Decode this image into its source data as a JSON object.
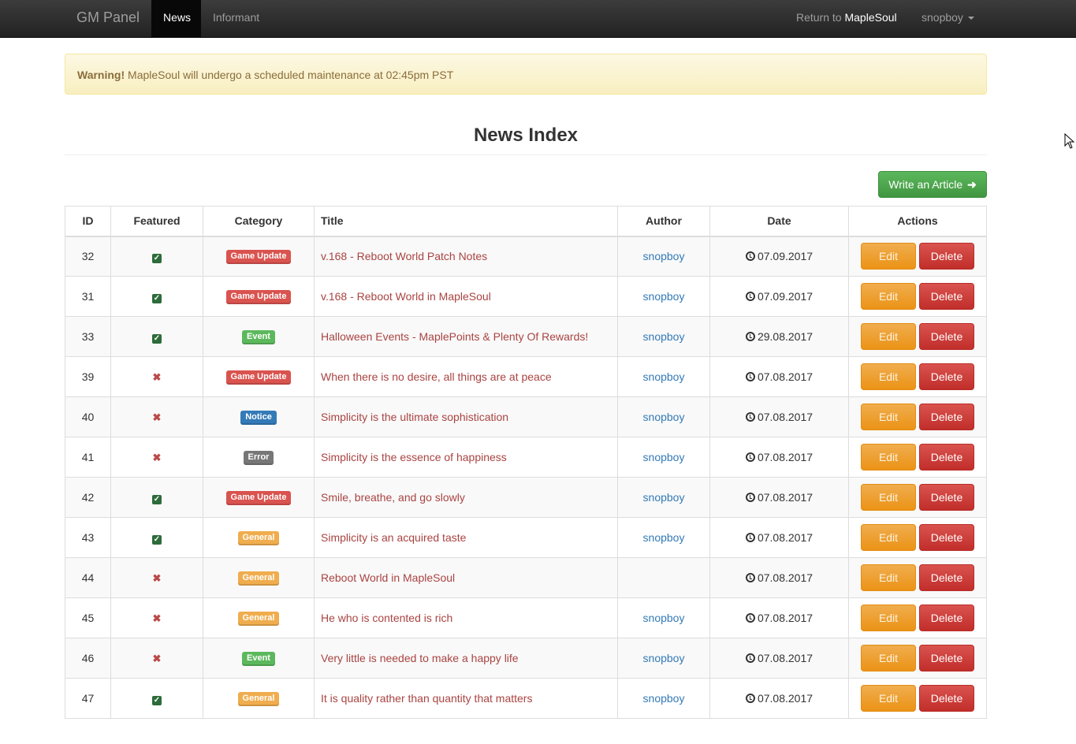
{
  "navbar": {
    "brand": "GM Panel",
    "items": [
      {
        "label": "News",
        "active": true
      },
      {
        "label": "Informant",
        "active": false
      }
    ],
    "return_prefix": "Return to ",
    "return_site": "MapleSoul",
    "user": "snopboy"
  },
  "alert": {
    "strong": "Warning!",
    "message": " MapleSoul will undergo a scheduled maintenance at 02:45pm PST"
  },
  "page": {
    "title": "News Index",
    "write_button": "Write an Article",
    "write_icon": "arrow-right-icon"
  },
  "table": {
    "headers": [
      "ID",
      "Featured",
      "Category",
      "Title",
      "Author",
      "Date",
      "Actions"
    ],
    "edit_label": "Edit",
    "delete_label": "Delete",
    "category_colors": {
      "Game Update": "#d9534f",
      "Event": "#5cb85c",
      "Notice": "#337ab7",
      "Error": "#777777",
      "General": "#f0ad4e"
    },
    "rows": [
      {
        "id": "32",
        "featured": true,
        "category": "Game Update",
        "title": "v.168 - Reboot World Patch Notes",
        "author": "snopboy",
        "date": "07.09.2017"
      },
      {
        "id": "31",
        "featured": true,
        "category": "Game Update",
        "title": "v.168 - Reboot World in MapleSoul",
        "author": "snopboy",
        "date": "07.09.2017"
      },
      {
        "id": "33",
        "featured": true,
        "category": "Event",
        "title": "Halloween Events - MaplePoints & Plenty Of Rewards!",
        "author": "snopboy",
        "date": "29.08.2017"
      },
      {
        "id": "39",
        "featured": false,
        "category": "Game Update",
        "title": "When there is no desire, all things are at peace",
        "author": "snopboy",
        "date": "07.08.2017"
      },
      {
        "id": "40",
        "featured": false,
        "category": "Notice",
        "title": "Simplicity is the ultimate sophistication",
        "author": "snopboy",
        "date": "07.08.2017"
      },
      {
        "id": "41",
        "featured": false,
        "category": "Error",
        "title": "Simplicity is the essence of happiness",
        "author": "snopboy",
        "date": "07.08.2017"
      },
      {
        "id": "42",
        "featured": true,
        "category": "Game Update",
        "title": "Smile, breathe, and go slowly",
        "author": "snopboy",
        "date": "07.08.2017"
      },
      {
        "id": "43",
        "featured": true,
        "category": "General",
        "title": "Simplicity is an acquired taste",
        "author": "snopboy",
        "date": "07.08.2017"
      },
      {
        "id": "44",
        "featured": false,
        "category": "General",
        "title": "Reboot World in MapleSoul",
        "author": "",
        "date": "07.08.2017"
      },
      {
        "id": "45",
        "featured": false,
        "category": "General",
        "title": "He who is contented is rich",
        "author": "snopboy",
        "date": "07.08.2017"
      },
      {
        "id": "46",
        "featured": false,
        "category": "Event",
        "title": "Very little is needed to make a happy life",
        "author": "snopboy",
        "date": "07.08.2017"
      },
      {
        "id": "47",
        "featured": true,
        "category": "General",
        "title": "It is quality rather than quantity that matters",
        "author": "snopboy",
        "date": "07.08.2017"
      }
    ]
  }
}
